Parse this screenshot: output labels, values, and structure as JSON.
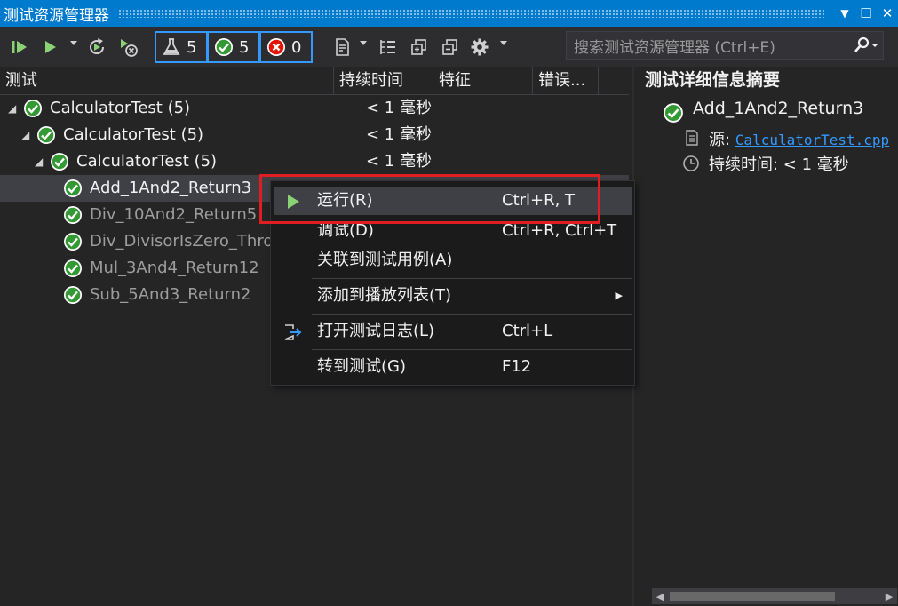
{
  "window": {
    "title": "测试资源管理器",
    "buttons": [
      "▼",
      "☐",
      "✕"
    ]
  },
  "toolbar": {
    "counts": {
      "total": "5",
      "passed": "5",
      "failed": "0"
    },
    "search_placeholder": "搜索测试资源管理器 (Ctrl+E)"
  },
  "columns": [
    "测试",
    "持续时间",
    "特征",
    "错误..."
  ],
  "tree": [
    {
      "label": "CalculatorTest  (5)",
      "duration": "< 1 毫秒",
      "level": 0,
      "expander": "◢",
      "dim": false
    },
    {
      "label": "CalculatorTest  (5)",
      "duration": "< 1 毫秒",
      "level": 1,
      "expander": "◢",
      "dim": false
    },
    {
      "label": "CalculatorTest  (5)",
      "duration": "< 1 毫秒",
      "level": 2,
      "expander": "◢",
      "dim": false
    },
    {
      "label": "Add_1And2_Return3",
      "duration": "",
      "level": 3,
      "expander": "",
      "dim": false,
      "selected": true
    },
    {
      "label": "Div_10And2_Return5",
      "duration": "",
      "level": 3,
      "expander": "",
      "dim": true
    },
    {
      "label": "Div_DivisorIsZero_Throw",
      "duration": "",
      "level": 3,
      "expander": "",
      "dim": true
    },
    {
      "label": "Mul_3And4_Return12",
      "duration": "",
      "level": 3,
      "expander": "",
      "dim": true
    },
    {
      "label": "Sub_5And3_Return2",
      "duration": "",
      "level": 3,
      "expander": "",
      "dim": true
    }
  ],
  "details": {
    "title": "测试详细信息摘要",
    "test_name": "Add_1And2_Return3",
    "source_label": "源: ",
    "source_link": "CalculatorTest.cpp",
    "duration_label": "持续时间: < 1 毫秒"
  },
  "context_menu": {
    "items": [
      {
        "label": "运行(R)",
        "shortcut": "Ctrl+R, T",
        "icon": "play-icon"
      },
      {
        "label": "调试(D)",
        "shortcut": "Ctrl+R, Ctrl+T"
      },
      {
        "label": "关联到测试用例(A)",
        "shortcut": ""
      },
      {
        "label": "添加到播放列表(T)",
        "shortcut": "",
        "submenu": "▶"
      },
      {
        "label": "打开测试日志(L)",
        "shortcut": "Ctrl+L",
        "icon": "open-log-icon"
      },
      {
        "label": "转到测试(G)",
        "shortcut": "F12"
      }
    ]
  },
  "colors": {
    "accent": "#007acc",
    "pass_green": "#339933",
    "fail_red": "#e51400",
    "highlight_red": "#e01e22",
    "link_blue": "#3399ff",
    "run_green": "#8bd175"
  }
}
